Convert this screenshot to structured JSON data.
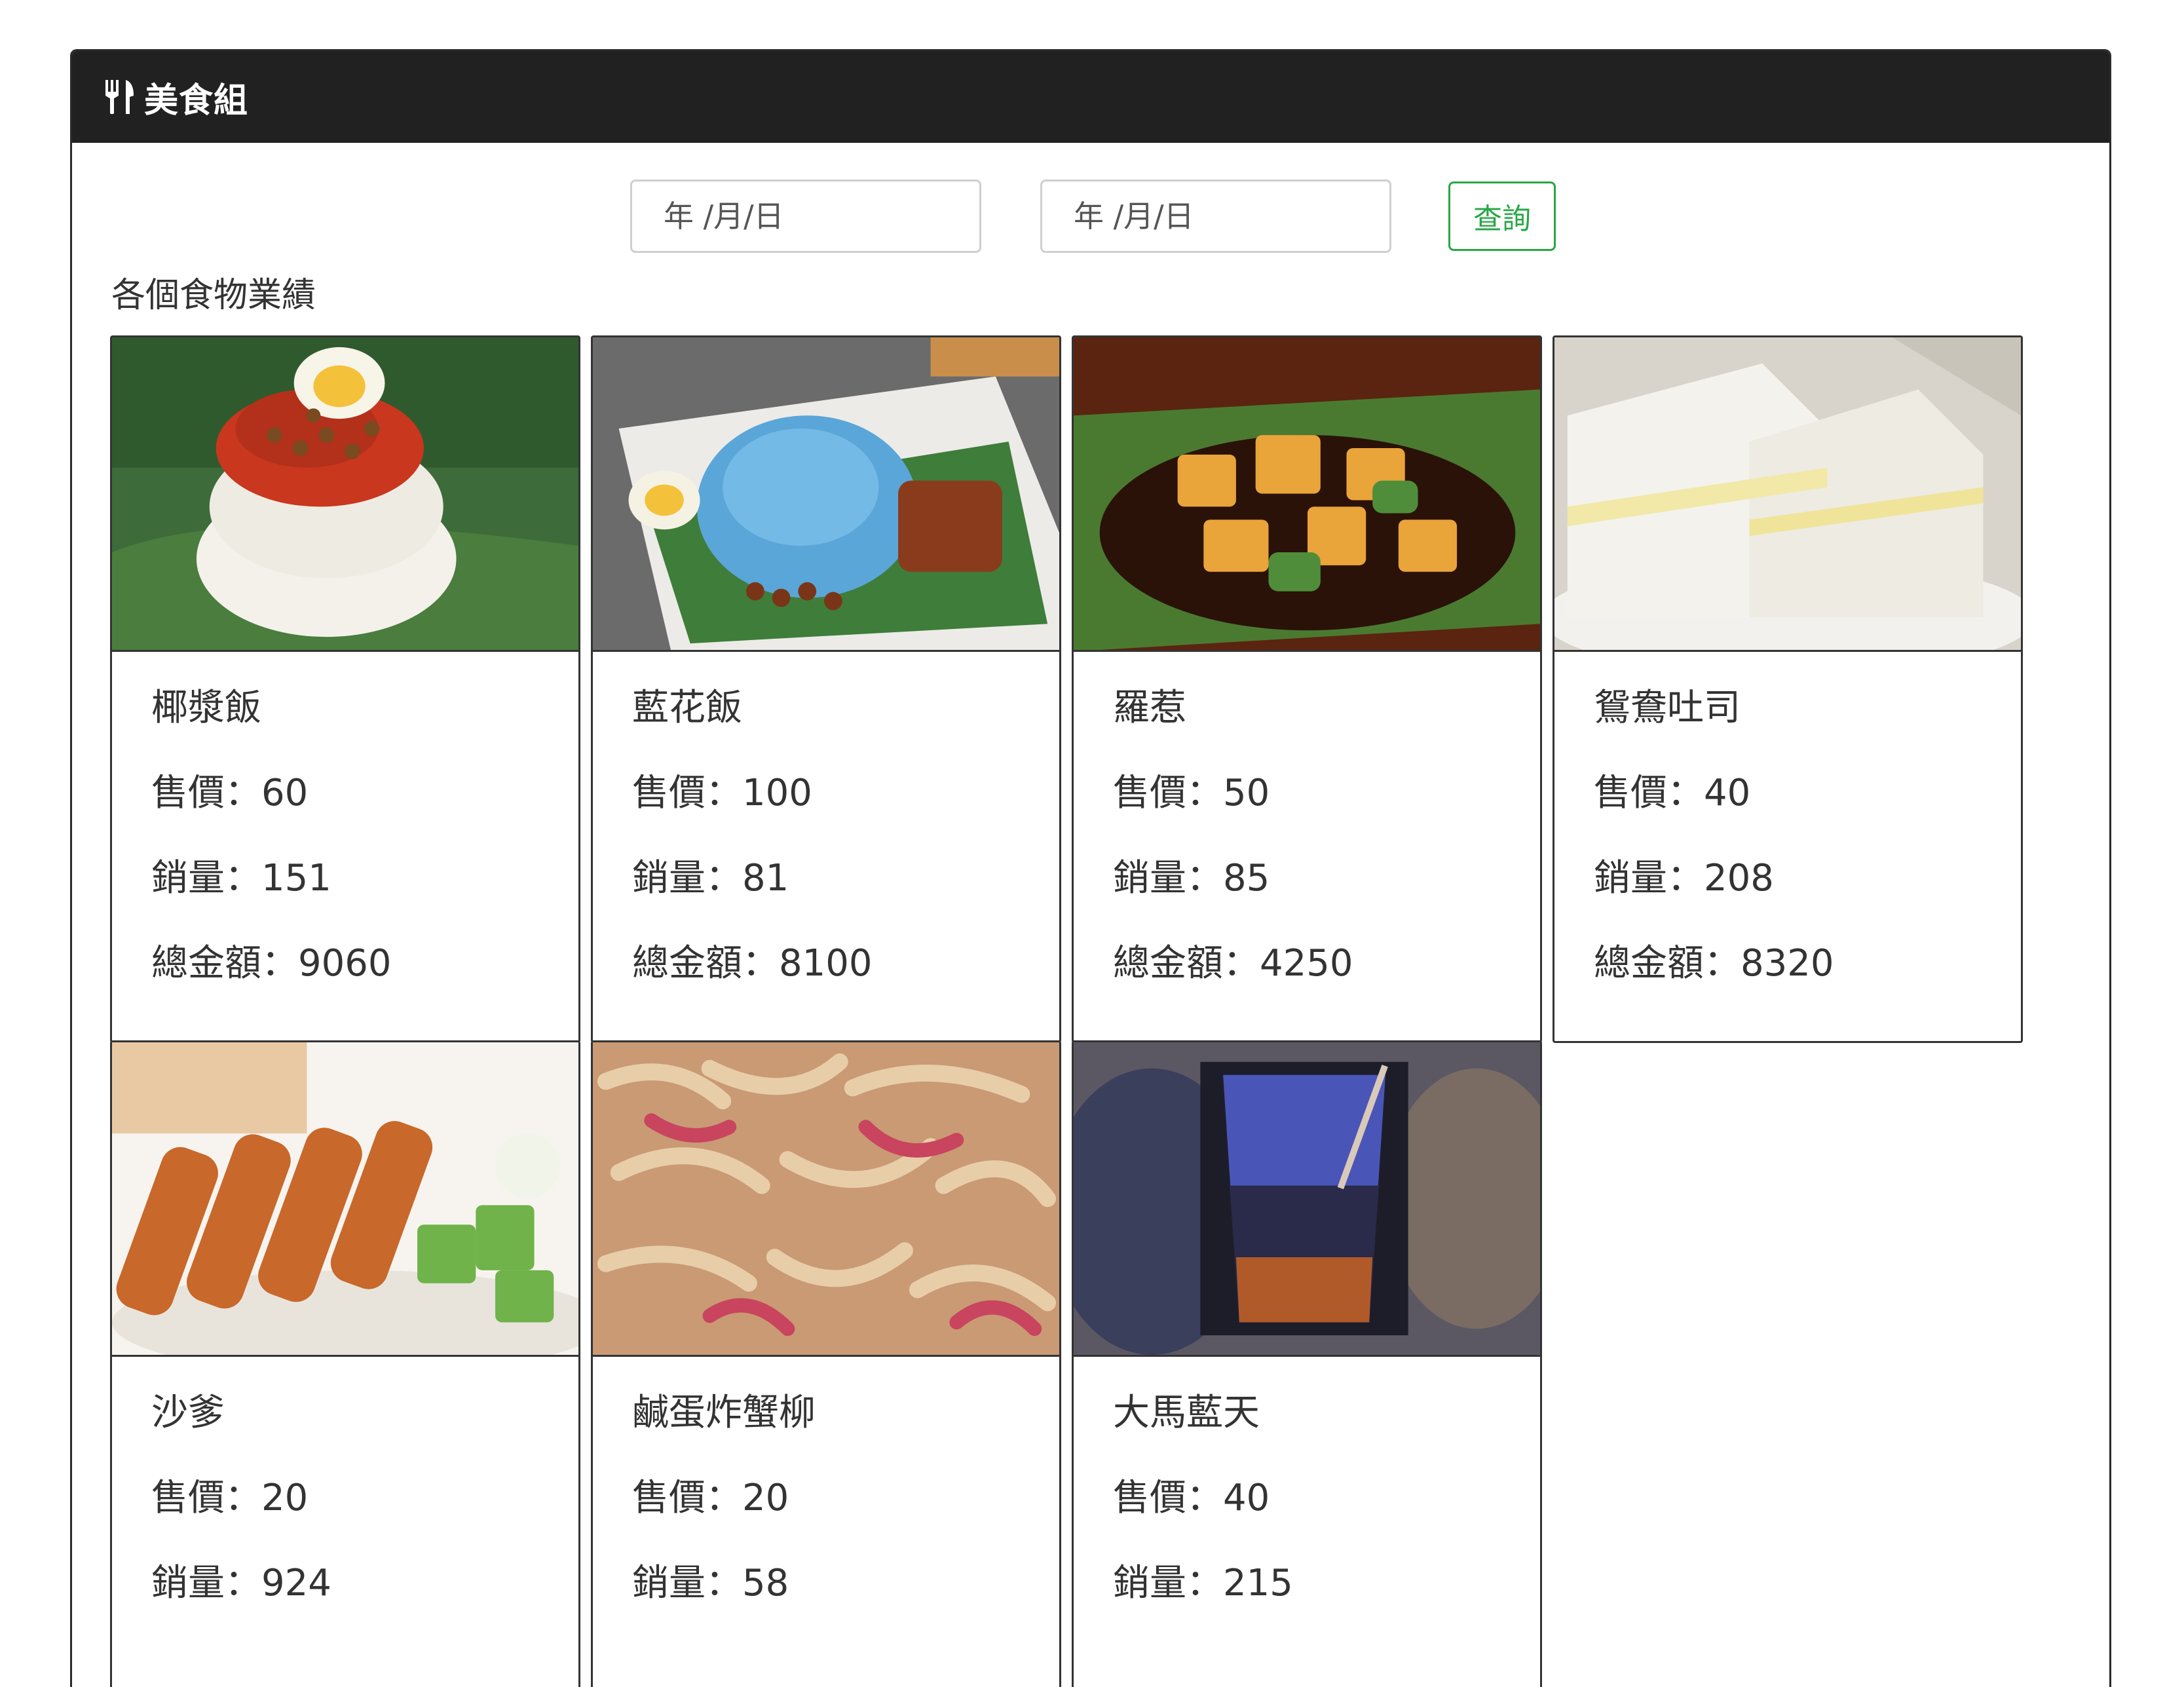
{
  "header": {
    "title": "美食組",
    "icon": "utensils-icon"
  },
  "filter": {
    "date_from_placeholder": "年 /月/日",
    "date_to_placeholder": "年 /月/日",
    "query_label": "查詢"
  },
  "section_label": "各個食物業績",
  "labels": {
    "price": "售價：",
    "qty": "銷量：",
    "total": "總金額："
  },
  "foods": [
    {
      "name": "椰漿飯",
      "price": "60",
      "qty": "151",
      "total": "9060"
    },
    {
      "name": "藍花飯",
      "price": "100",
      "qty": "81",
      "total": "8100"
    },
    {
      "name": "羅惹",
      "price": "50",
      "qty": "85",
      "total": "4250"
    },
    {
      "name": "鴛鴦吐司",
      "price": "40",
      "qty": "208",
      "total": "8320"
    },
    {
      "name": "沙爹",
      "price": "20",
      "qty": "924",
      "total": ""
    },
    {
      "name": "鹹蛋炸蟹柳",
      "price": "20",
      "qty": "58",
      "total": ""
    },
    {
      "name": "大馬藍天",
      "price": "40",
      "qty": "215",
      "total": ""
    }
  ],
  "colors": {
    "header_bg": "#212121",
    "accent_green": "#28a745"
  }
}
